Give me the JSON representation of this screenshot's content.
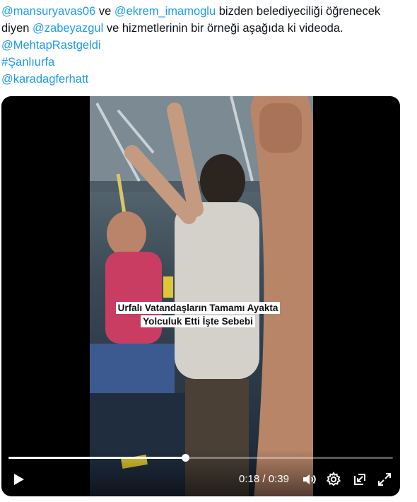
{
  "tweet": {
    "line1": {
      "m1": "@mansuryavas06",
      "t1": " ve ",
      "m2": "@ekrem_imamoglu",
      "t2": " bizden belediyeciliği öğrenecek"
    },
    "line2": {
      "t1": "diyen ",
      "m1": "@zabeyazgul",
      "t2": " ve hizmetlerinin bir örneği aşağıda ki videoda."
    },
    "line3": "@MehtapRastgeldi",
    "line4": "#Şanlıurfa",
    "line5": "@karadagferhatt",
    "colors": {
      "text": "#0f1419",
      "link": "#1d9bf0"
    }
  },
  "video": {
    "caption_line1": "Urfalı Vatandaşların Tamamı Ayakta",
    "caption_line2": "Yolculuk Etti İşte Sebebi",
    "progress_fraction": 0.46,
    "time_current": "0:18",
    "time_separator": " / ",
    "time_total": "0:39",
    "icons": {
      "play": "play-icon",
      "volume": "volume-icon",
      "settings": "settings-gear-icon",
      "exit_minimize": "minimize-video-icon",
      "fullscreen": "fullscreen-icon"
    }
  }
}
